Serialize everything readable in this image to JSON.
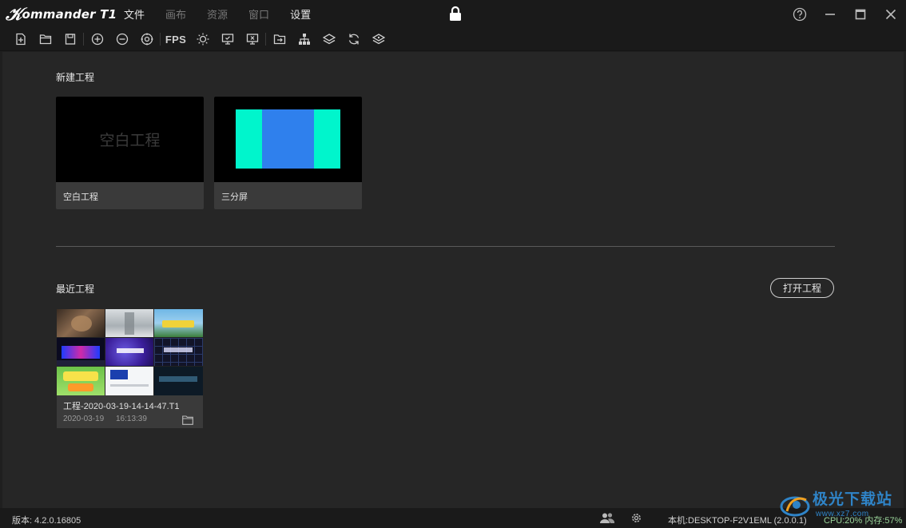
{
  "app": {
    "logo_k": "𝒦",
    "logo_text": "ommander T1"
  },
  "menu": [
    {
      "label": "文件",
      "enabled": true
    },
    {
      "label": "画布",
      "enabled": false
    },
    {
      "label": "资源",
      "enabled": false
    },
    {
      "label": "窗口",
      "enabled": false
    },
    {
      "label": "设置",
      "enabled": true
    }
  ],
  "toolbar": {
    "fps_label": "FPS"
  },
  "new_project": {
    "section_title": "新建工程",
    "templates": [
      {
        "name": "空白工程",
        "thumb_text": "空白工程"
      },
      {
        "name": "三分屏",
        "colors": [
          "#00f5cc",
          "#2f80ed",
          "#00f5cc"
        ]
      }
    ]
  },
  "recent": {
    "section_title": "最近工程",
    "open_button": "打开工程",
    "projects": [
      {
        "name": "工程-2020-03-19-14-14-47.T1",
        "date": "2020-03-19",
        "time": "16:13:39"
      }
    ]
  },
  "status": {
    "version": "版本: 4.2.0.16805",
    "host": "本机:DESKTOP-F2V1EML (2.0.0.1)",
    "cpu": "CPU:20% 内存:57%"
  },
  "watermark": {
    "text": "极光下载站",
    "url": "www.xz7.com"
  }
}
